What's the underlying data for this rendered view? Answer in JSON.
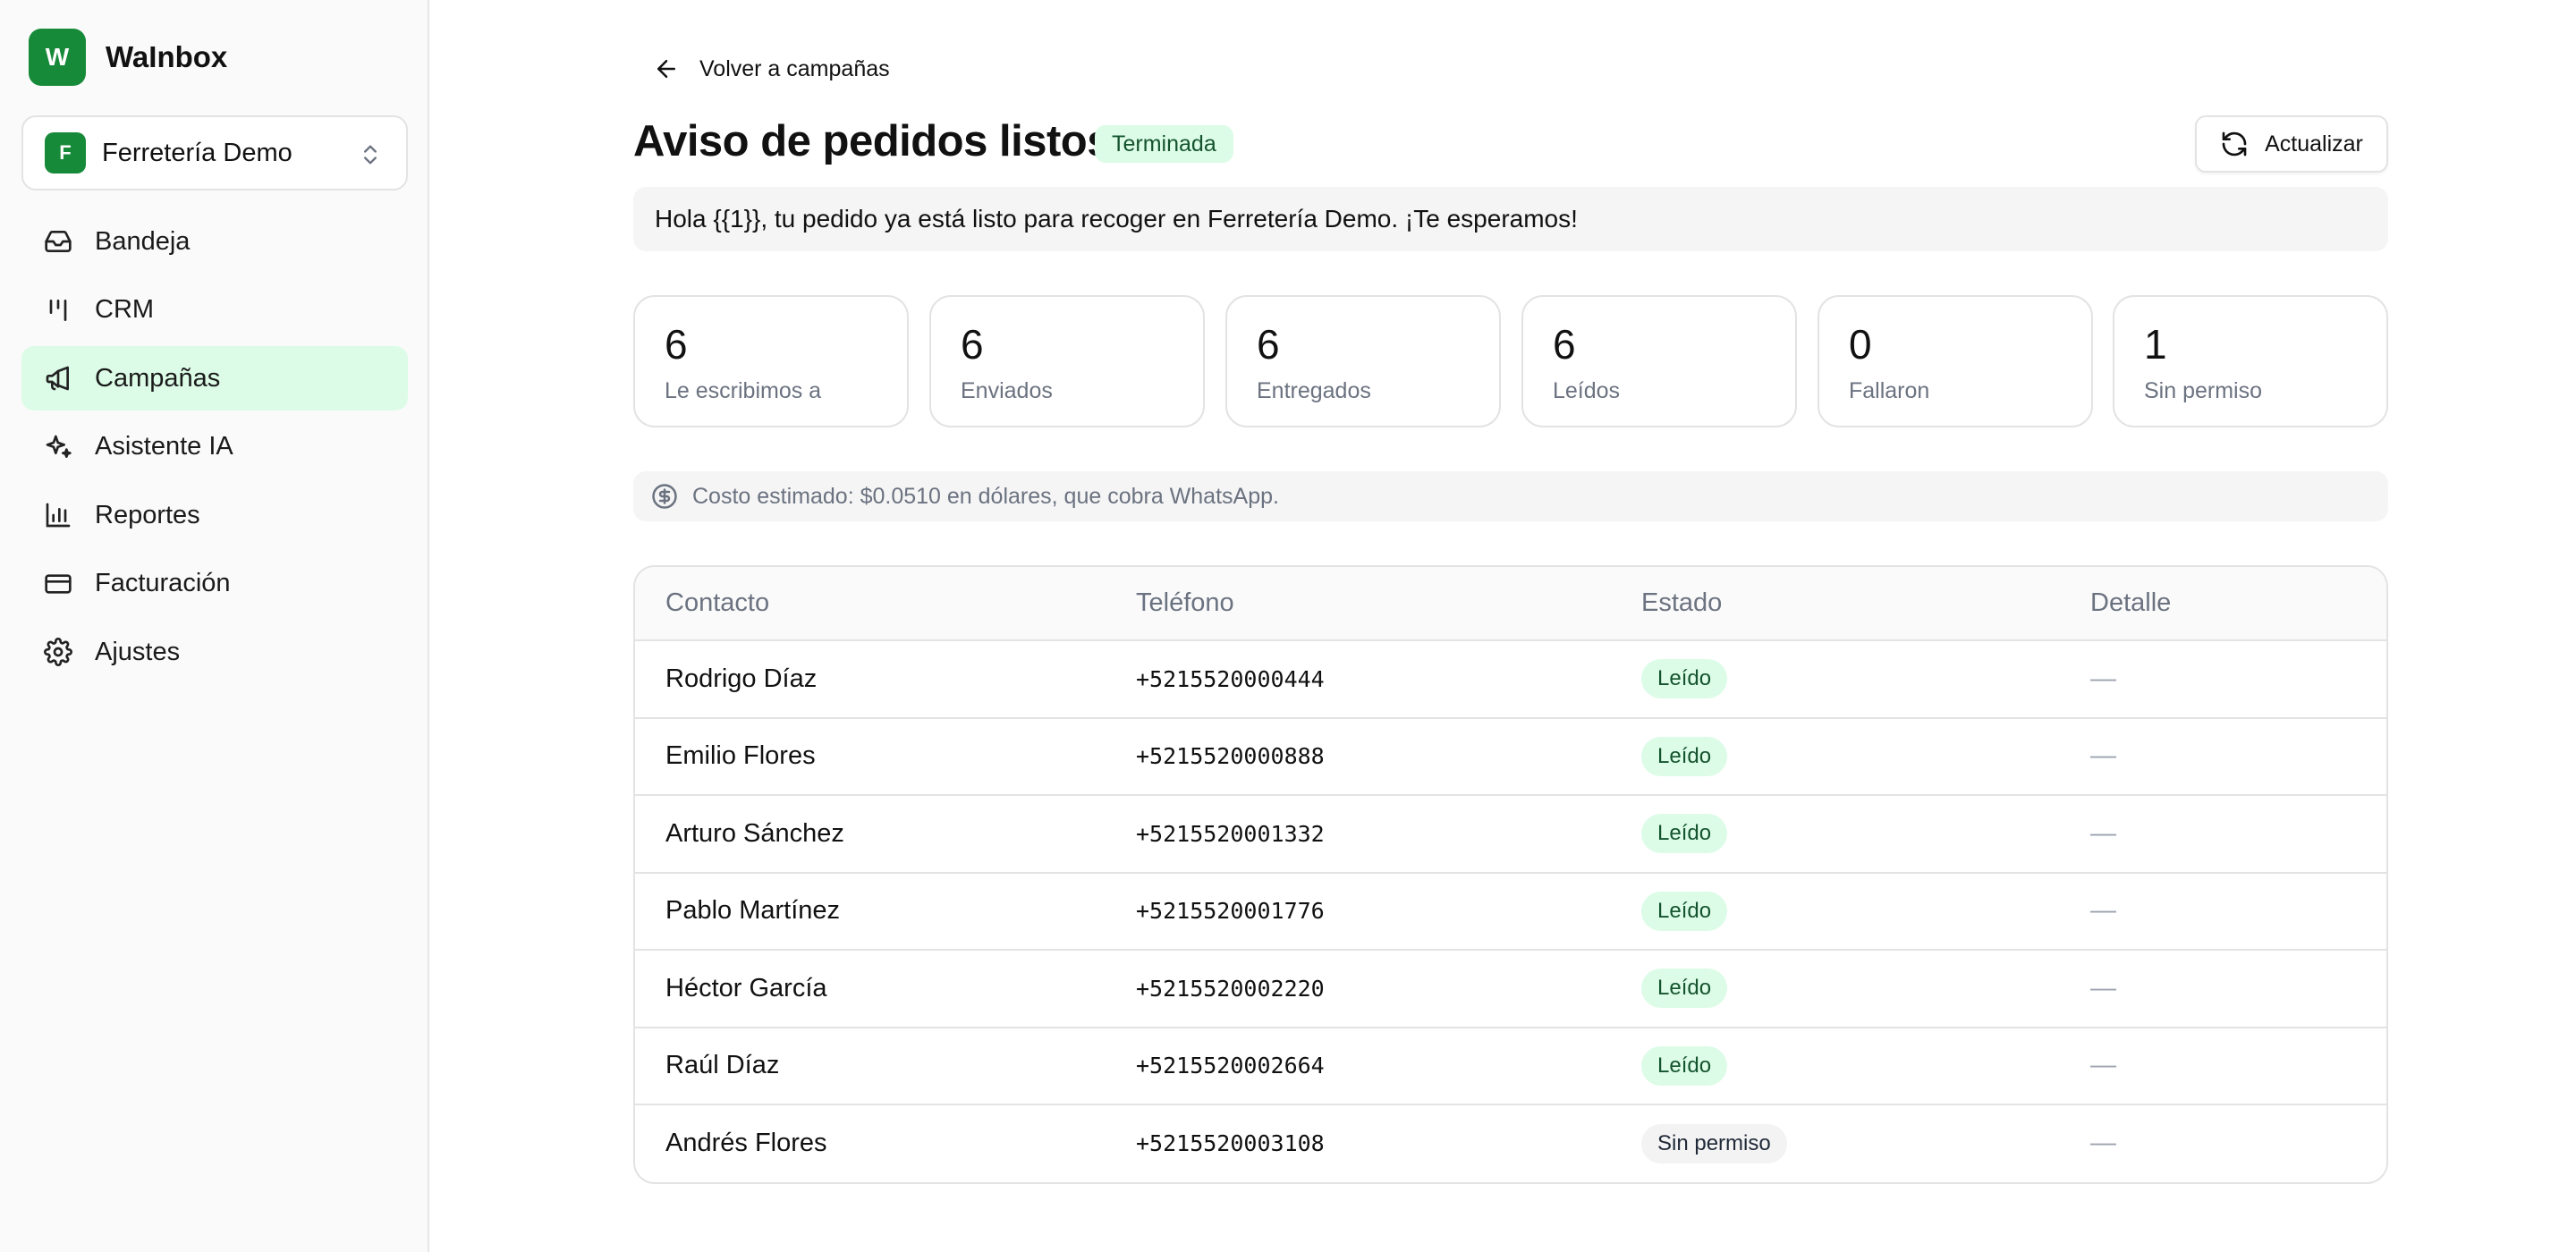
{
  "brand": {
    "initial": "W",
    "name": "WaInbox",
    "color": "#178a3a"
  },
  "org": {
    "initial": "F",
    "name": "Ferretería Demo"
  },
  "nav": [
    {
      "label": "Bandeja",
      "icon": "inbox-icon",
      "active": false
    },
    {
      "label": "CRM",
      "icon": "kanban-icon",
      "active": false
    },
    {
      "label": "Campañas",
      "icon": "megaphone-icon",
      "active": true
    },
    {
      "label": "Asistente IA",
      "icon": "sparkles-icon",
      "active": false
    },
    {
      "label": "Reportes",
      "icon": "bar-chart-icon",
      "active": false
    },
    {
      "label": "Facturación",
      "icon": "credit-card-icon",
      "active": false
    },
    {
      "label": "Ajustes",
      "icon": "gear-icon",
      "active": false
    }
  ],
  "back_label": "Volver a campañas",
  "campaign": {
    "title": "Aviso de pedidos listos",
    "status": "Terminada",
    "message": "Hola {{1}}, tu pedido ya está listo para recoger en Ferretería Demo. ¡Te esperamos!"
  },
  "refresh_label": "Actualizar",
  "stats": [
    {
      "value": "6",
      "label": "Le escribimos a"
    },
    {
      "value": "6",
      "label": "Enviados"
    },
    {
      "value": "6",
      "label": "Entregados"
    },
    {
      "value": "6",
      "label": "Leídos"
    },
    {
      "value": "0",
      "label": "Fallaron"
    },
    {
      "value": "1",
      "label": "Sin permiso"
    }
  ],
  "cost_note": "Costo estimado: $0.0510 en dólares, que cobra WhatsApp.",
  "table": {
    "headers": [
      "Contacto",
      "Teléfono",
      "Estado",
      "Detalle"
    ],
    "rows": [
      {
        "contact": "Rodrigo Díaz",
        "phone": "+5215520000444",
        "status": "Leído",
        "detail": "—"
      },
      {
        "contact": "Emilio Flores",
        "phone": "+5215520000888",
        "status": "Leído",
        "detail": "—"
      },
      {
        "contact": "Arturo Sánchez",
        "phone": "+5215520001332",
        "status": "Leído",
        "detail": "—"
      },
      {
        "contact": "Pablo Martínez",
        "phone": "+5215520001776",
        "status": "Leído",
        "detail": "—"
      },
      {
        "contact": "Héctor García",
        "phone": "+5215520002220",
        "status": "Leído",
        "detail": "—"
      },
      {
        "contact": "Raúl Díaz",
        "phone": "+5215520002664",
        "status": "Leído",
        "detail": "—"
      },
      {
        "contact": "Andrés Flores",
        "phone": "+5215520003108",
        "status": "Sin permiso",
        "detail": "—"
      }
    ]
  },
  "colors": {
    "accent": "#178a3a",
    "active_bg": "#dcfce7",
    "read_pill": "#dcfce7",
    "noperm_pill": "#f3f3f3"
  }
}
